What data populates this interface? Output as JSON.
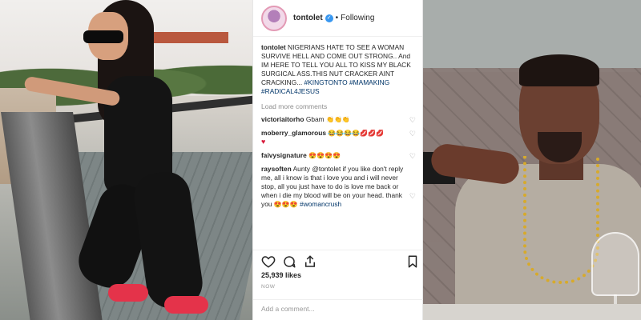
{
  "post": {
    "username": "tontolet",
    "verified_mark": "✓",
    "separator": "•",
    "follow_status": "Following",
    "caption": {
      "user": "tontolet",
      "text": "NIGERIANS HATE TO SEE A WOMAN SURVIVE HELL AND COME OUT STRONG.. And IM HERE TO TELL YOU ALL TO KISS MY BLACK SURGICAL ASS.THIS NUT CRACKER AINT CRACKING...",
      "tags": [
        "#KINGTONTO",
        "#MAMAKING",
        "#RADICAL4JESUS"
      ]
    },
    "load_more": "Load more comments",
    "comments": [
      {
        "user": "victoriaitorho",
        "text": "Gbam",
        "emoji": "👏👏👏"
      },
      {
        "user": "moberry_glamorous",
        "text": "",
        "emoji": "😂😂😂😂💋💋💋",
        "extra": "♥"
      },
      {
        "user": "faivysignature",
        "text": "",
        "emoji": "😍😍😍😍"
      },
      {
        "user": "raysoften",
        "text": "Aunty @tontolet if you like don't reply me, all i know is that i love you and i will never stop, all you just have to do is love me back or when i die my blood will be on your head. thank you",
        "emoji": "😍😍😍",
        "tag": "#womancrush"
      }
    ],
    "likes": "25,939 likes",
    "time": "NOW",
    "add_comment_placeholder": "Add a comment..."
  },
  "colors": {
    "link": "#003569",
    "verified": "#3897f0",
    "muted": "#8e8e8e",
    "slipper": "#e4334a"
  },
  "icons": [
    "heart-icon",
    "comment-icon",
    "share-icon",
    "bookmark-icon",
    "small-heart-icon"
  ]
}
